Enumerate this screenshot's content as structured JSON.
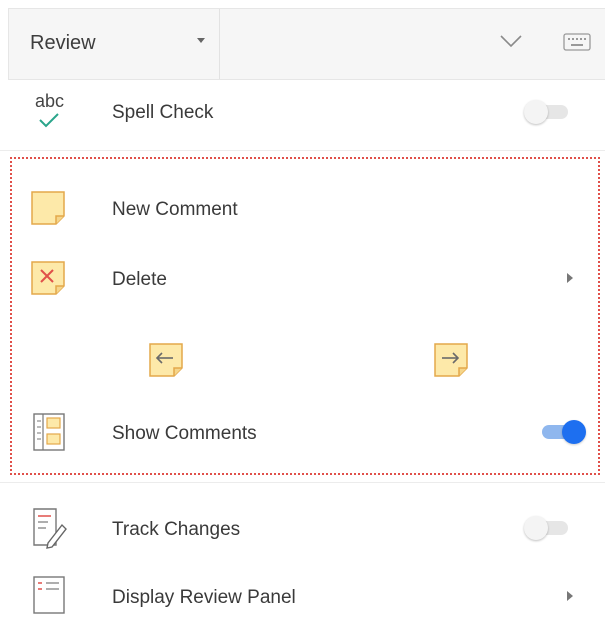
{
  "header": {
    "tab_label": "Review",
    "caret_icon": "caret-down-icon",
    "collapse_icon": "chevron-down-icon",
    "keyboard_icon": "keyboard-icon"
  },
  "items": {
    "spell_check": {
      "label": "Spell Check",
      "icon": "spell-check-icon",
      "toggle_on": false
    },
    "new_comment": {
      "label": "New Comment",
      "icon": "new-comment-icon"
    },
    "delete": {
      "label": "Delete",
      "icon": "delete-comment-icon",
      "submenu_icon": "chevron-right-icon"
    },
    "previous_comment": {
      "icon": "previous-comment-icon"
    },
    "next_comment": {
      "icon": "next-comment-icon"
    },
    "show_comments": {
      "label": "Show Comments",
      "icon": "show-comments-icon",
      "toggle_on": true
    },
    "track_changes": {
      "label": "Track Changes",
      "icon": "track-changes-icon",
      "toggle_on": false
    },
    "display_review_panel": {
      "label": "Display Review Panel",
      "icon": "review-panel-icon",
      "submenu_icon": "chevron-right-icon"
    }
  },
  "colors": {
    "accent_blue": "#1d6ff0",
    "note_fill": "#fde9a9",
    "note_border": "#e3a84a",
    "highlight_border": "#e0504a",
    "check_green": "#2aa58b"
  }
}
